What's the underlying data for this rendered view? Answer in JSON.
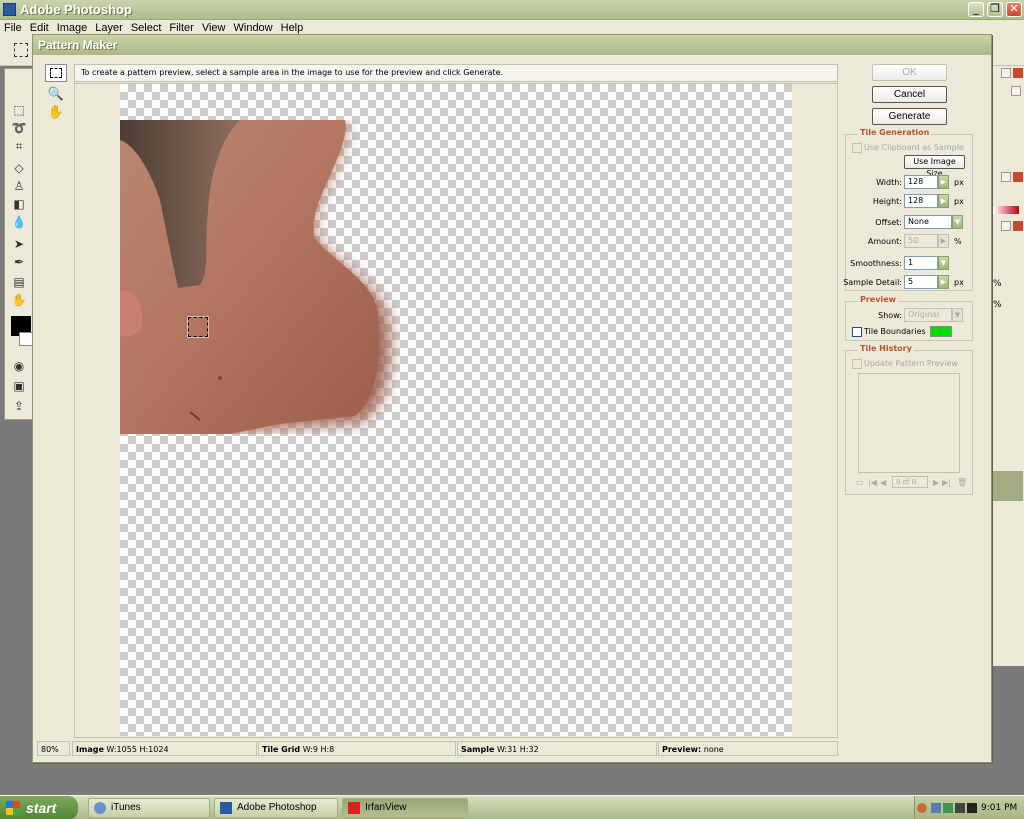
{
  "app": {
    "title": "Adobe Photoshop",
    "menu": [
      "File",
      "Edit",
      "Image",
      "Layer",
      "Select",
      "Filter",
      "View",
      "Window",
      "Help"
    ]
  },
  "dialog": {
    "title": "Pattern Maker",
    "instructions": "To create a pattern preview, select a sample area in the image to use for the preview and click Generate.",
    "buttons": {
      "ok": "OK",
      "cancel": "Cancel",
      "generate": "Generate"
    },
    "tile_generation": {
      "title": "Tile Generation",
      "use_clipboard_label": "Use Clipboard as Sample",
      "use_image_size_label": "Use Image Size",
      "width_label": "Width:",
      "width_value": "128",
      "height_label": "Height:",
      "height_value": "128",
      "px": "px",
      "offset_label": "Offset:",
      "offset_value": "None",
      "amount_label": "Amount:",
      "amount_value": "50",
      "percent": "%",
      "smoothness_label": "Smoothness:",
      "smoothness_value": "1",
      "sample_detail_label": "Sample Detail:",
      "sample_detail_value": "5"
    },
    "preview": {
      "title": "Preview",
      "show_label": "Show:",
      "show_value": "Original",
      "tile_boundaries_label": "Tile Boundaries",
      "boundary_color": "#00e000"
    },
    "tile_history": {
      "title": "Tile History",
      "update_label": "Update Pattern Preview",
      "counter": "0 of 0"
    },
    "status": {
      "zoom": "80%",
      "image_label": "Image",
      "image_value": "W:1055 H:1024",
      "tilegrid_label": "Tile Grid",
      "tilegrid_value": "W:9 H:8",
      "sample_label": "Sample",
      "sample_value": "W:31 H:32",
      "preview_label": "Preview:",
      "preview_value": "none"
    }
  },
  "taskbar": {
    "start": "start",
    "tasks": [
      "iTunes",
      "Adobe Photoshop",
      "IrfanView"
    ],
    "clock": "9:01 PM"
  },
  "right_palette": {
    "pct1": "%",
    "pct2": "%"
  }
}
